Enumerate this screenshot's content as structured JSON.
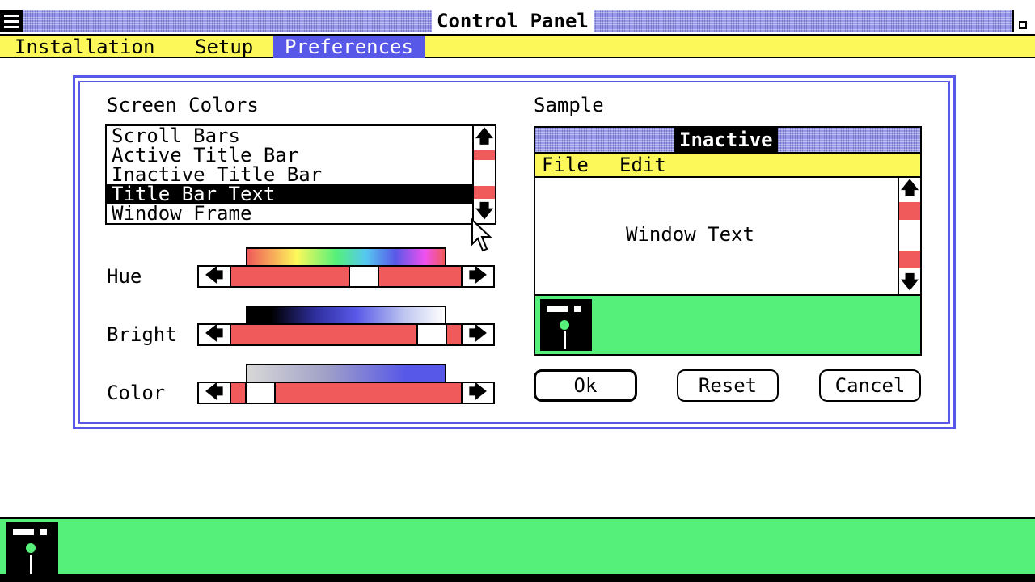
{
  "window": {
    "title": "Control Panel"
  },
  "menu": {
    "items": [
      {
        "label": "Installation"
      },
      {
        "label": "Setup"
      },
      {
        "label": "Preferences"
      }
    ],
    "active": "Preferences"
  },
  "dialog": {
    "screen_colors_label": "Screen Colors",
    "list_items": [
      {
        "label": "Scroll Bars"
      },
      {
        "label": "Active Title Bar"
      },
      {
        "label": "Inactive Title Bar"
      },
      {
        "label": "Title Bar Text"
      },
      {
        "label": "Window Frame"
      }
    ],
    "selected_item": "Title Bar Text",
    "sliders": {
      "hue": {
        "label": "Hue",
        "value_fraction": 0.59
      },
      "bright": {
        "label": "Bright",
        "value_fraction": 0.93
      },
      "color": {
        "label": "Color",
        "value_fraction": 0.07
      }
    },
    "sample": {
      "label": "Sample",
      "title": "Inactive",
      "menu_file": "File",
      "menu_edit": "Edit",
      "window_text": "Window Text"
    },
    "buttons": {
      "ok": "Ok",
      "reset": "Reset",
      "cancel": "Cancel"
    }
  },
  "arrows": {
    "up": "🡅",
    "down": "🡇",
    "left": "🡄",
    "right": "🡆"
  },
  "colors": {
    "desktop": "#55f07a",
    "menu_bar": "#fcf85a",
    "highlight": "#5858e8",
    "scrollbar": "#f05a5a",
    "title_pattern": "#9a9ae8"
  }
}
